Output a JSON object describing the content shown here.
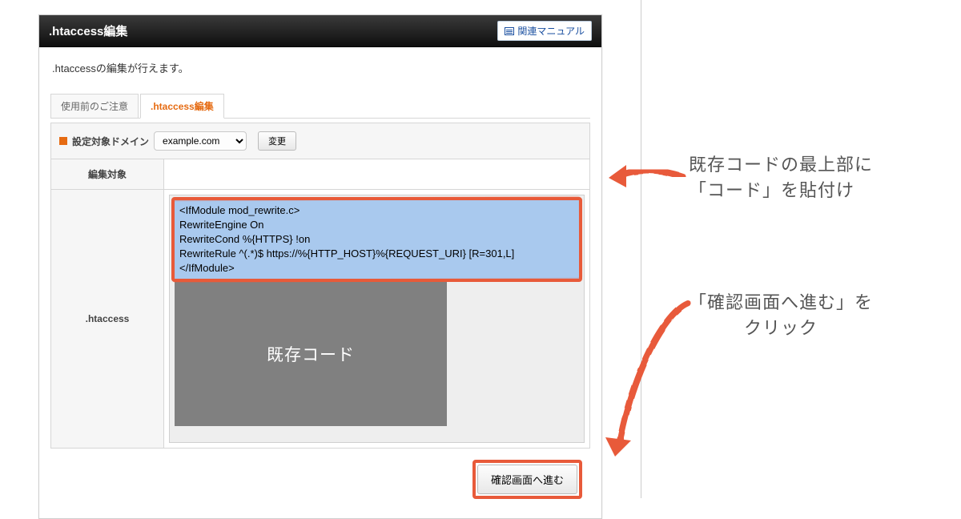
{
  "header": {
    "title": ".htaccess編集",
    "related_manual_label": "関連マニュアル"
  },
  "description": ".htaccessの編集が行えます。",
  "tabs": {
    "caution": "使用前のご注意",
    "edit": ".htaccess編集"
  },
  "settings": {
    "target_domain_label": "設定対象ドメイン",
    "domain_value": "example.com",
    "change_button_label": "変更",
    "edit_target_label": "編集対象",
    "htaccess_label": ".htaccess",
    "code_lines": "<IfModule mod_rewrite.c>\nRewriteEngine On\nRewriteCond %{HTTPS} !on\nRewriteRule ^(.*)$ https://%{HTTP_HOST}%{REQUEST_URI} [R=301,L]\n</IfModule>",
    "existing_code_placeholder": "既存コード",
    "confirm_button_label": "確認画面へ進む"
  },
  "annotations": {
    "note1_line1": "既存コードの最上部に",
    "note1_line2": "「コード」を貼付け",
    "note2_line1": "「確認画面へ進む」を",
    "note2_line2": "クリック"
  }
}
